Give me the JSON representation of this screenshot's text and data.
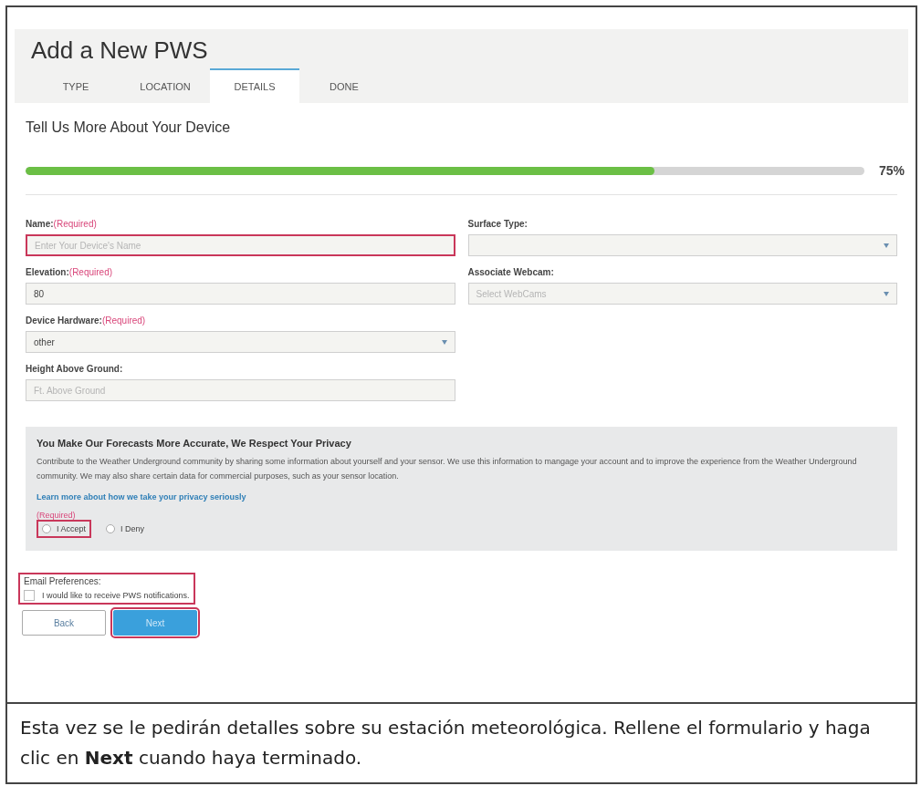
{
  "header": {
    "title": "Add a New PWS"
  },
  "tabs": [
    {
      "label": "TYPE",
      "selected": false
    },
    {
      "label": "LOCATION",
      "selected": false
    },
    {
      "label": "DETAILS",
      "selected": true
    },
    {
      "label": "DONE",
      "selected": false
    }
  ],
  "section_title": "Tell Us More About Your Device",
  "progress": {
    "level": 0.75,
    "reading": "75%"
  },
  "left_fields": [
    {
      "kind": "text",
      "label": "Name:",
      "required": "(Required)",
      "placeholder": "Enter Your Device's Name",
      "highlighted": true
    },
    {
      "kind": "text",
      "label": "Elevation:",
      "required": "(Required)",
      "value": "80",
      "highlighted": false
    },
    {
      "kind": "select",
      "label": "Device Hardware:",
      "required": "(Required)",
      "value": "other",
      "highlighted": false
    },
    {
      "kind": "text",
      "label": "Height Above Ground:",
      "placeholder": "Ft. Above Ground",
      "highlighted": false
    }
  ],
  "right_fields": [
    {
      "kind": "select",
      "label": "Surface Type:",
      "highlighted": false
    },
    {
      "kind": "select",
      "label": "Associate Webcam:",
      "placeholder": "Select WebCams",
      "highlighted": false
    }
  ],
  "privacy": {
    "title": "You Make Our Forecasts More Accurate, We Respect Your Privacy",
    "text": "Contribute to the Weather Underground community by sharing some information about yourself and your sensor. We use this information to mangage your account and to improve the experience from the Weather Underground community. We may also share certain data for commercial purposes, such as your sensor location.",
    "link": "Learn more about how we take your privacy seriously",
    "required": "(Required)",
    "options": [
      {
        "label": "I Accept",
        "selected": false,
        "highlighted": true
      },
      {
        "label": "I Deny",
        "selected": false,
        "highlighted": false
      }
    ]
  },
  "email_preferences": {
    "label": "Email Preferences:",
    "option": "I would like to receive PWS notifications.",
    "checked": false,
    "highlighted": true
  },
  "buttons": [
    {
      "kind": "secondary",
      "label": "Back",
      "highlighted": false
    },
    {
      "kind": "primary",
      "label": "Next",
      "highlighted": true
    }
  ],
  "caption": "Esta vez se le pedirán detalles sobre su estación meteorológica. Rellene el formulario y haga clic en **Next** cuando haya terminado."
}
